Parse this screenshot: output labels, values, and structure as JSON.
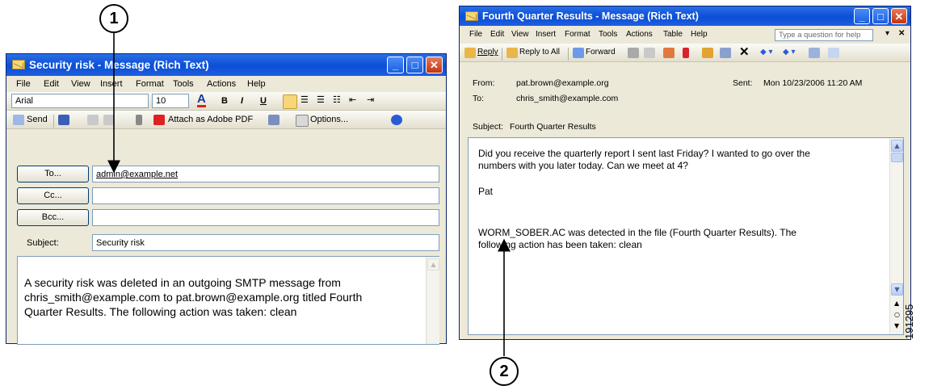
{
  "left_window": {
    "title": "Security risk - Message (Rich Text)",
    "menu": [
      "File",
      "Edit",
      "View",
      "Insert",
      "Format",
      "Tools",
      "Actions",
      "Help"
    ],
    "format_toolbar": {
      "font": "Arial",
      "size": "10",
      "bold": "B",
      "italic": "I",
      "underline": "U"
    },
    "standard_toolbar": {
      "send": "Send",
      "attach_pdf": "Attach as Adobe PDF",
      "options": "Options..."
    },
    "to_button": "To...",
    "cc_button": "Cc...",
    "bcc_button": "Bcc...",
    "to_value": "admin@example.net",
    "cc_value": "",
    "bcc_value": "",
    "subject_label": "Subject:",
    "subject_value": "Security risk",
    "body_lines": [
      "A security risk was deleted in an outgoing SMTP message from",
      "chris_smith@example.com to pat.brown@example.org titled Fourth",
      "Quarter Results. The following action was taken: clean"
    ]
  },
  "right_window": {
    "title": "Fourth Quarter Results - Message (Rich Text)",
    "menu": [
      "File",
      "Edit",
      "View",
      "Insert",
      "Format",
      "Tools",
      "Actions",
      "Table",
      "Help"
    ],
    "help_placeholder": "Type a question for help",
    "toolbar": {
      "reply": "Reply",
      "reply_all": "Reply to All",
      "forward": "Forward"
    },
    "from_label": "From:",
    "from_value": "pat.brown@example.org",
    "to_label": "To:",
    "to_value": "chris_smith@example.com",
    "sent_label": "Sent:",
    "sent_value": "Mon 10/23/2006 11:20 AM",
    "subject_label": "Subject:",
    "subject_value": "Fourth Quarter Results",
    "body_lines": [
      "Did you receive the quarterly report I sent last Friday? I wanted to go over the",
      "numbers with you later today.  Can we meet at 4?",
      "Pat",
      "WORM_SOBER.AC was detected in the file (Fourth Quarter Results). The",
      "following action has been taken: clean"
    ]
  },
  "callouts": [
    "1",
    "2"
  ],
  "figure_id": "191295",
  "colors": {
    "titlebar": "#0a4fd6",
    "window_bg": "#ece9d8",
    "close_button": "#c2350f"
  }
}
